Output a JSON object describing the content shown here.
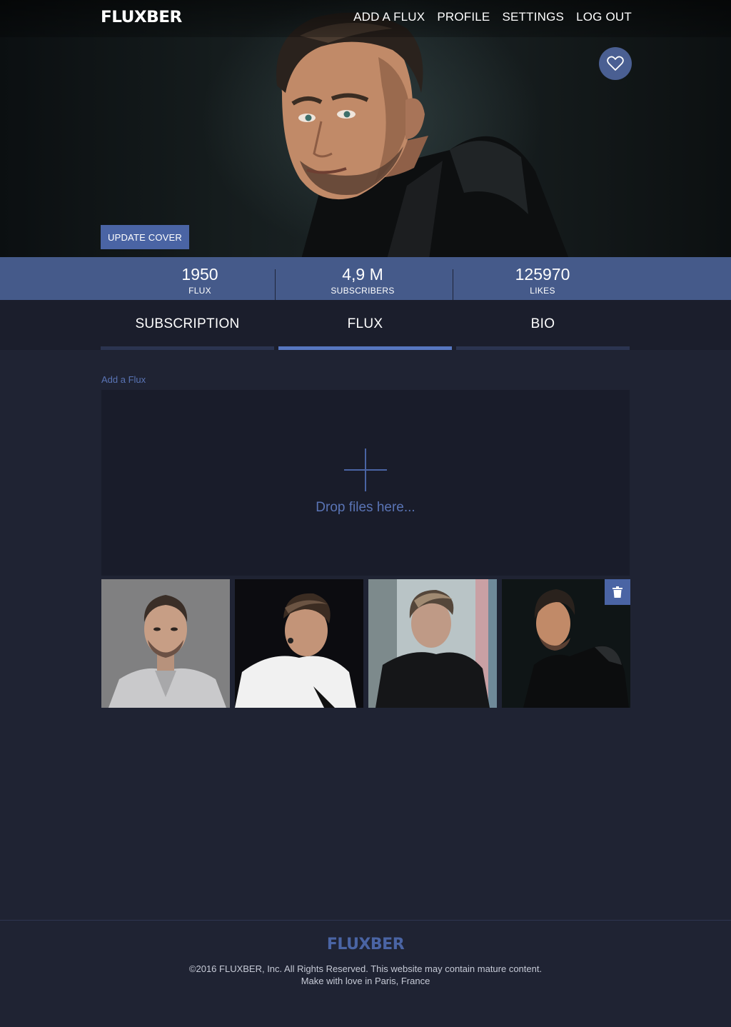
{
  "brand": {
    "logo": "FLUXBER"
  },
  "nav": {
    "items": [
      {
        "label": "ADD A FLUX"
      },
      {
        "label": "PROFILE"
      },
      {
        "label": "SETTINGS"
      },
      {
        "label": "LOG OUT"
      }
    ]
  },
  "hero": {
    "favorite_icon": "heart-outline-icon",
    "update_cover_label": "UPDATE COVER"
  },
  "stats": [
    {
      "value": "1950",
      "label": "FLUX"
    },
    {
      "value": "4,9 M",
      "label": "SUBSCRIBERS"
    },
    {
      "value": "125970",
      "label": "LIKES"
    }
  ],
  "tabs": [
    {
      "label": "SUBSCRIPTION",
      "active": false
    },
    {
      "label": "FLUX",
      "active": true
    },
    {
      "label": "BIO",
      "active": false
    }
  ],
  "upload": {
    "section_label": "Add a Flux",
    "drop_text": "Drop files here...",
    "plus_icon": "plus-icon"
  },
  "gallery": {
    "delete_icon": "trash-icon",
    "photos": [
      {
        "icon": "photo-thumbnail"
      },
      {
        "icon": "photo-thumbnail"
      },
      {
        "icon": "photo-thumbnail"
      },
      {
        "icon": "photo-thumbnail"
      }
    ]
  },
  "colors": {
    "accent": "#4a64a4",
    "stats_bar": "#455a8a",
    "background": "#1f2333"
  },
  "footer": {
    "logo": "FLUXBER",
    "copyright": "©2016 FLUXBER, Inc. All Rights Reserved. This website may contain mature content.",
    "tagline": "Make with love in Paris, France"
  }
}
